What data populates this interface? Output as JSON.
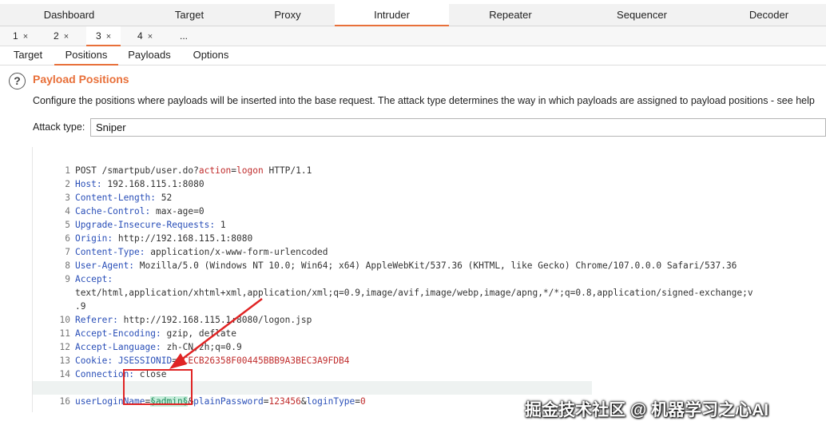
{
  "main_tabs": [
    "Dashboard",
    "Target",
    "Proxy",
    "Intruder",
    "Repeater",
    "Sequencer",
    "Decoder"
  ],
  "main_tab_active": "Intruder",
  "sub_tabs": [
    {
      "label": "1",
      "close": "×"
    },
    {
      "label": "2",
      "close": "×"
    },
    {
      "label": "3",
      "close": "×"
    },
    {
      "label": "4",
      "close": "×"
    },
    {
      "label": "...",
      "close": ""
    }
  ],
  "sub_tab_active": "3",
  "inner_tabs": [
    "Target",
    "Positions",
    "Payloads",
    "Options"
  ],
  "inner_tab_active": "Positions",
  "section": {
    "help_icon": "?",
    "title": "Payload Positions",
    "description": "Configure the positions where payloads will be inserted into the base request. The attack type determines the way in which payloads are assigned to payload positions - see help"
  },
  "attack": {
    "label": "Attack type:",
    "value": "Sniper"
  },
  "request": {
    "l1": {
      "num": "1",
      "method": "POST /smartpub/user.do?",
      "pkey": "action",
      "eq": "=",
      "pval": "logon",
      "rest": " HTTP/1.1"
    },
    "l2": {
      "num": "2",
      "key": "Host:",
      "val": " 192.168.115.1:8080"
    },
    "l3": {
      "num": "3",
      "key": "Content-Length:",
      "val": " 52"
    },
    "l4": {
      "num": "4",
      "key": "Cache-Control:",
      "val": " max-age=0"
    },
    "l5": {
      "num": "5",
      "key": "Upgrade-Insecure-Requests:",
      "val": " 1"
    },
    "l6": {
      "num": "6",
      "key": "Origin:",
      "val": " http://192.168.115.1:8080"
    },
    "l7": {
      "num": "7",
      "key": "Content-Type:",
      "val": " application/x-www-form-urlencoded"
    },
    "l8": {
      "num": "8",
      "key": "User-Agent:",
      "val": " Mozilla/5.0 (Windows NT 10.0; Win64; x64) AppleWebKit/537.36 (KHTML, like Gecko) Chrome/107.0.0.0 Safari/537.36"
    },
    "l9": {
      "num": "9",
      "key": "Accept:",
      "cont1": "text/html,application/xhtml+xml,application/xml;q=0.9,image/avif,image/webp,image/apng,*/*;q=0.8,application/signed-exchange;v",
      "cont2": ".9"
    },
    "l10": {
      "num": "10",
      "key": "Referer:",
      "val": " http://192.168.115.1:8080/logon.jsp"
    },
    "l11": {
      "num": "11",
      "key": "Accept-Encoding:",
      "val": " gzip, deflate"
    },
    "l12": {
      "num": "12",
      "key": "Accept-Language:",
      "val": " zh-CN,zh;q=0.9"
    },
    "l13": {
      "num": "13",
      "key": "Cookie:",
      "ckey": " JSESSIONID",
      "eq": "=",
      "cval": "ACECB26358F00445BBB9A3BEC3A9FDB4"
    },
    "l14": {
      "num": "14",
      "key": "Connection:",
      "val": " close"
    },
    "l15": {
      "num": "15"
    },
    "l16": {
      "num": "16",
      "k1": "userLoginName",
      "eq1": "=",
      "marked": "§admin§",
      "amp1": "&",
      "k2": "plainPassword",
      "eq2": "=",
      "v2": "123456",
      "amp2": "&",
      "k3": "loginType",
      "eq3": "=",
      "v3": "0"
    }
  },
  "watermark": "掘金技术社区 @ 机器学习之心AI",
  "colors": {
    "accent": "#e8703a",
    "header_key": "#2a4fb8",
    "param_value": "#c02c2c",
    "payload_marker_bg": "#c7eedc",
    "annotation": "#e02424"
  },
  "icons": [
    "help-icon",
    "close-icon",
    "annotation-arrow"
  ]
}
